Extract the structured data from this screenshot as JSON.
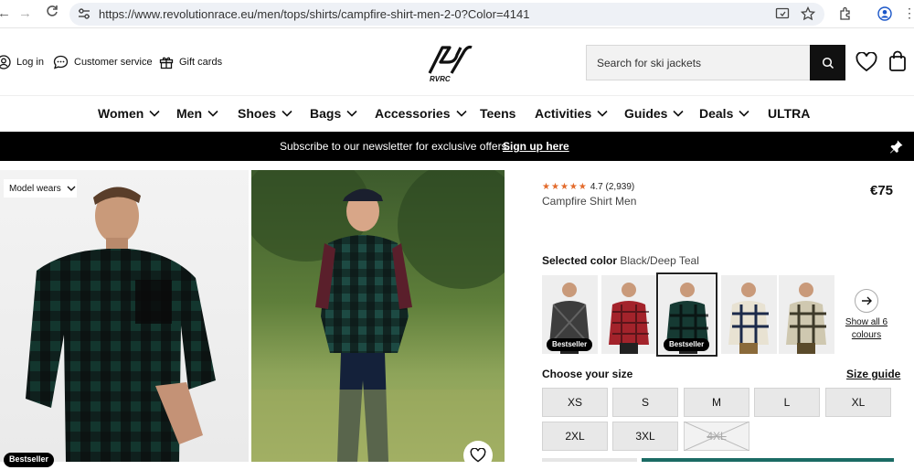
{
  "browser": {
    "url": "https://www.revolutionrace.eu/men/tops/shirts/campfire-shirt-men-2-0?Color=4141"
  },
  "header": {
    "login": "Log in",
    "customer_service": "Customer service",
    "gift_cards": "Gift cards",
    "logo_text": "RVRC",
    "search_placeholder": "Search for ski jackets"
  },
  "nav": {
    "items": [
      "Women",
      "Men",
      "Shoes",
      "Bags",
      "Accessories",
      "Teens",
      "Activities",
      "Guides",
      "Deals",
      "ULTRA"
    ]
  },
  "promo": {
    "text": "Subscribe to our newsletter for exclusive offers.",
    "link": "Sign up here"
  },
  "gallery": {
    "model_wears": "Model wears",
    "badge": "Bestseller"
  },
  "product": {
    "rating": "4.7 (2,939)",
    "rating_value": 4.7,
    "name": "Campfire Shirt Men",
    "price": "€75",
    "selected_color_label": "Selected color",
    "selected_color_value": "Black/Deep Teal",
    "badge": "Bestseller",
    "show_all_colors": "Show all 6 colours",
    "size_title": "Choose your size",
    "size_guide": "Size guide",
    "sizes": [
      "XS",
      "S",
      "M",
      "L",
      "XL",
      "2XL",
      "3XL",
      "4XL"
    ],
    "unavailable_sizes": [
      "4XL"
    ]
  },
  "colors": {
    "accent_teal": "#1b6b64",
    "star_orange": "#e36b2c"
  }
}
